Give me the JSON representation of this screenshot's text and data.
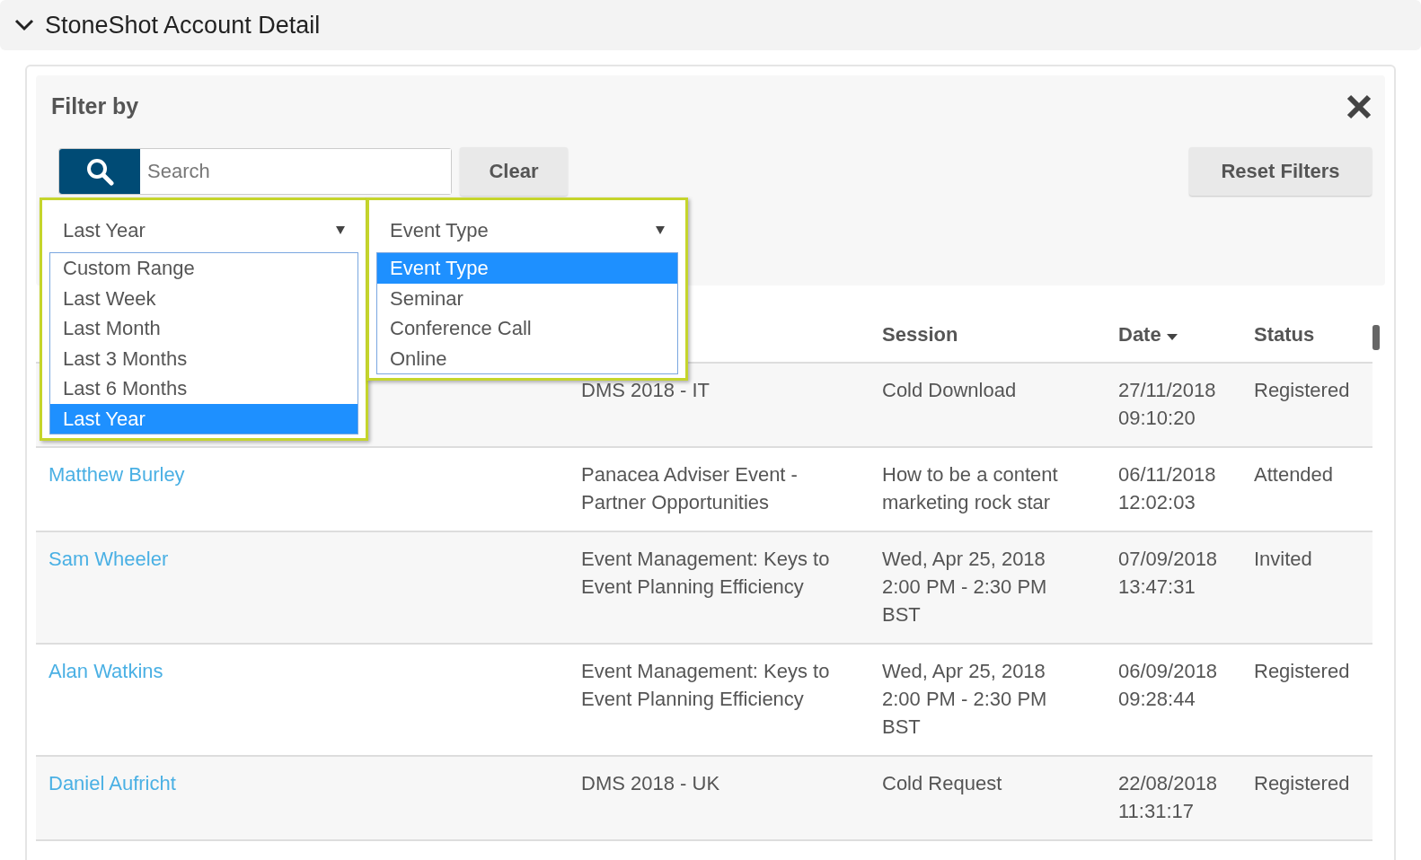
{
  "section": {
    "title": "StoneShot Account Detail",
    "expanded": true
  },
  "filter": {
    "title": "Filter by",
    "search": {
      "placeholder": "Search"
    },
    "clear_button": "Clear",
    "reset_button": "Reset Filters"
  },
  "dropdowns": [
    {
      "value": "Last Year",
      "options": [
        {
          "label": "Custom Range",
          "selected": false
        },
        {
          "label": "Last Week",
          "selected": false
        },
        {
          "label": "Last Month",
          "selected": false
        },
        {
          "label": "Last 3 Months",
          "selected": false
        },
        {
          "label": "Last 6 Months",
          "selected": false
        },
        {
          "label": "Last Year",
          "selected": true
        }
      ]
    },
    {
      "value": "Event Type",
      "options": [
        {
          "label": "Event Type",
          "selected": true
        },
        {
          "label": "Seminar",
          "selected": false
        },
        {
          "label": "Conference Call",
          "selected": false
        },
        {
          "label": "Online",
          "selected": false
        }
      ]
    }
  ],
  "table": {
    "columns": [
      {
        "label": "Session",
        "sorted": false
      },
      {
        "label": "Date",
        "sorted": true
      },
      {
        "label": "Status",
        "sorted": false
      }
    ],
    "rows": [
      {
        "event": "DMS 2018 - IT",
        "session": "Cold Download",
        "date": [
          "27/11/2018",
          "09:10:20"
        ],
        "status": "Registered"
      },
      {
        "name": "Matthew Burley",
        "event": "Panacea Adviser Event - Partner Opportunities",
        "session": "How to be a content marketing rock star",
        "date": [
          "06/11/2018",
          "12:02:03"
        ],
        "status": "Attended"
      },
      {
        "name": "Sam Wheeler",
        "event": "Event Management: Keys to Event Planning Efficiency",
        "session": "Wed, Apr 25, 2018 2:00 PM - 2:30 PM BST",
        "date": [
          "07/09/2018",
          "13:47:31"
        ],
        "status": "Invited"
      },
      {
        "name": "Alan Watkins",
        "event": "Event Management: Keys to Event Planning Efficiency",
        "session": "Wed, Apr 25, 2018 2:00 PM - 2:30 PM BST",
        "date": [
          "06/09/2018",
          "09:28:44"
        ],
        "status": "Registered"
      },
      {
        "name": "Daniel Aufricht",
        "event": "DMS 2018 - UK",
        "session": "Cold Request",
        "date": [
          "22/08/2018",
          "11:31:17"
        ],
        "status": "Registered"
      }
    ]
  }
}
